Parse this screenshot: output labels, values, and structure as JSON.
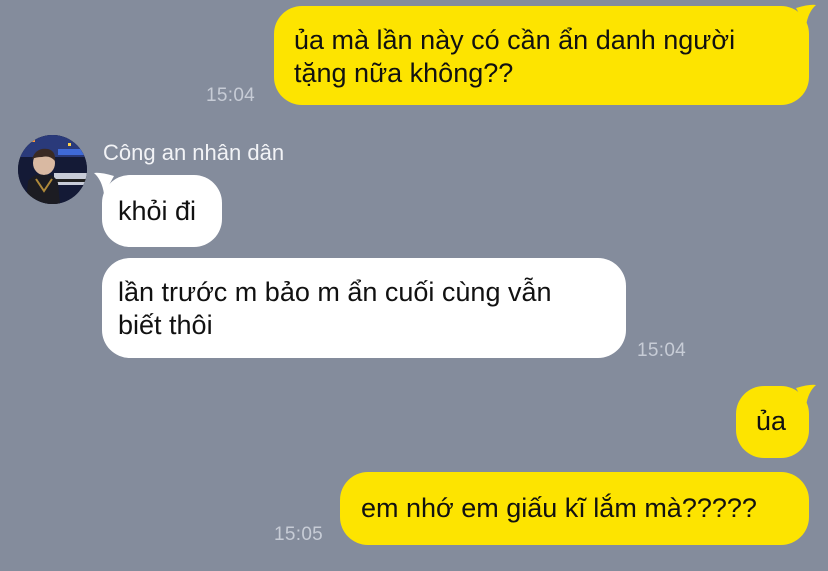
{
  "chat": {
    "messages": [
      {
        "direction": "outgoing",
        "text": "ủa mà lần này có cần ẩn danh người\ntặng nữa không??",
        "time": "15:04"
      },
      {
        "direction": "incoming",
        "sender": "Công an nhân dân",
        "text": "khỏi đi",
        "time": ""
      },
      {
        "direction": "incoming",
        "text": "lần trước m bảo m ẩn cuối cùng vẫn\nbiết thôi",
        "time": "15:04"
      },
      {
        "direction": "outgoing",
        "text": "ủa",
        "time": ""
      },
      {
        "direction": "outgoing",
        "text": "em nhớ em giấu kĩ lắm mà?????",
        "time": "15:05"
      }
    ]
  },
  "colors": {
    "background": "#848c9c",
    "outgoing_bubble": "#fde400",
    "incoming_bubble": "#ffffff",
    "timestamp": "#c7ccd6"
  }
}
